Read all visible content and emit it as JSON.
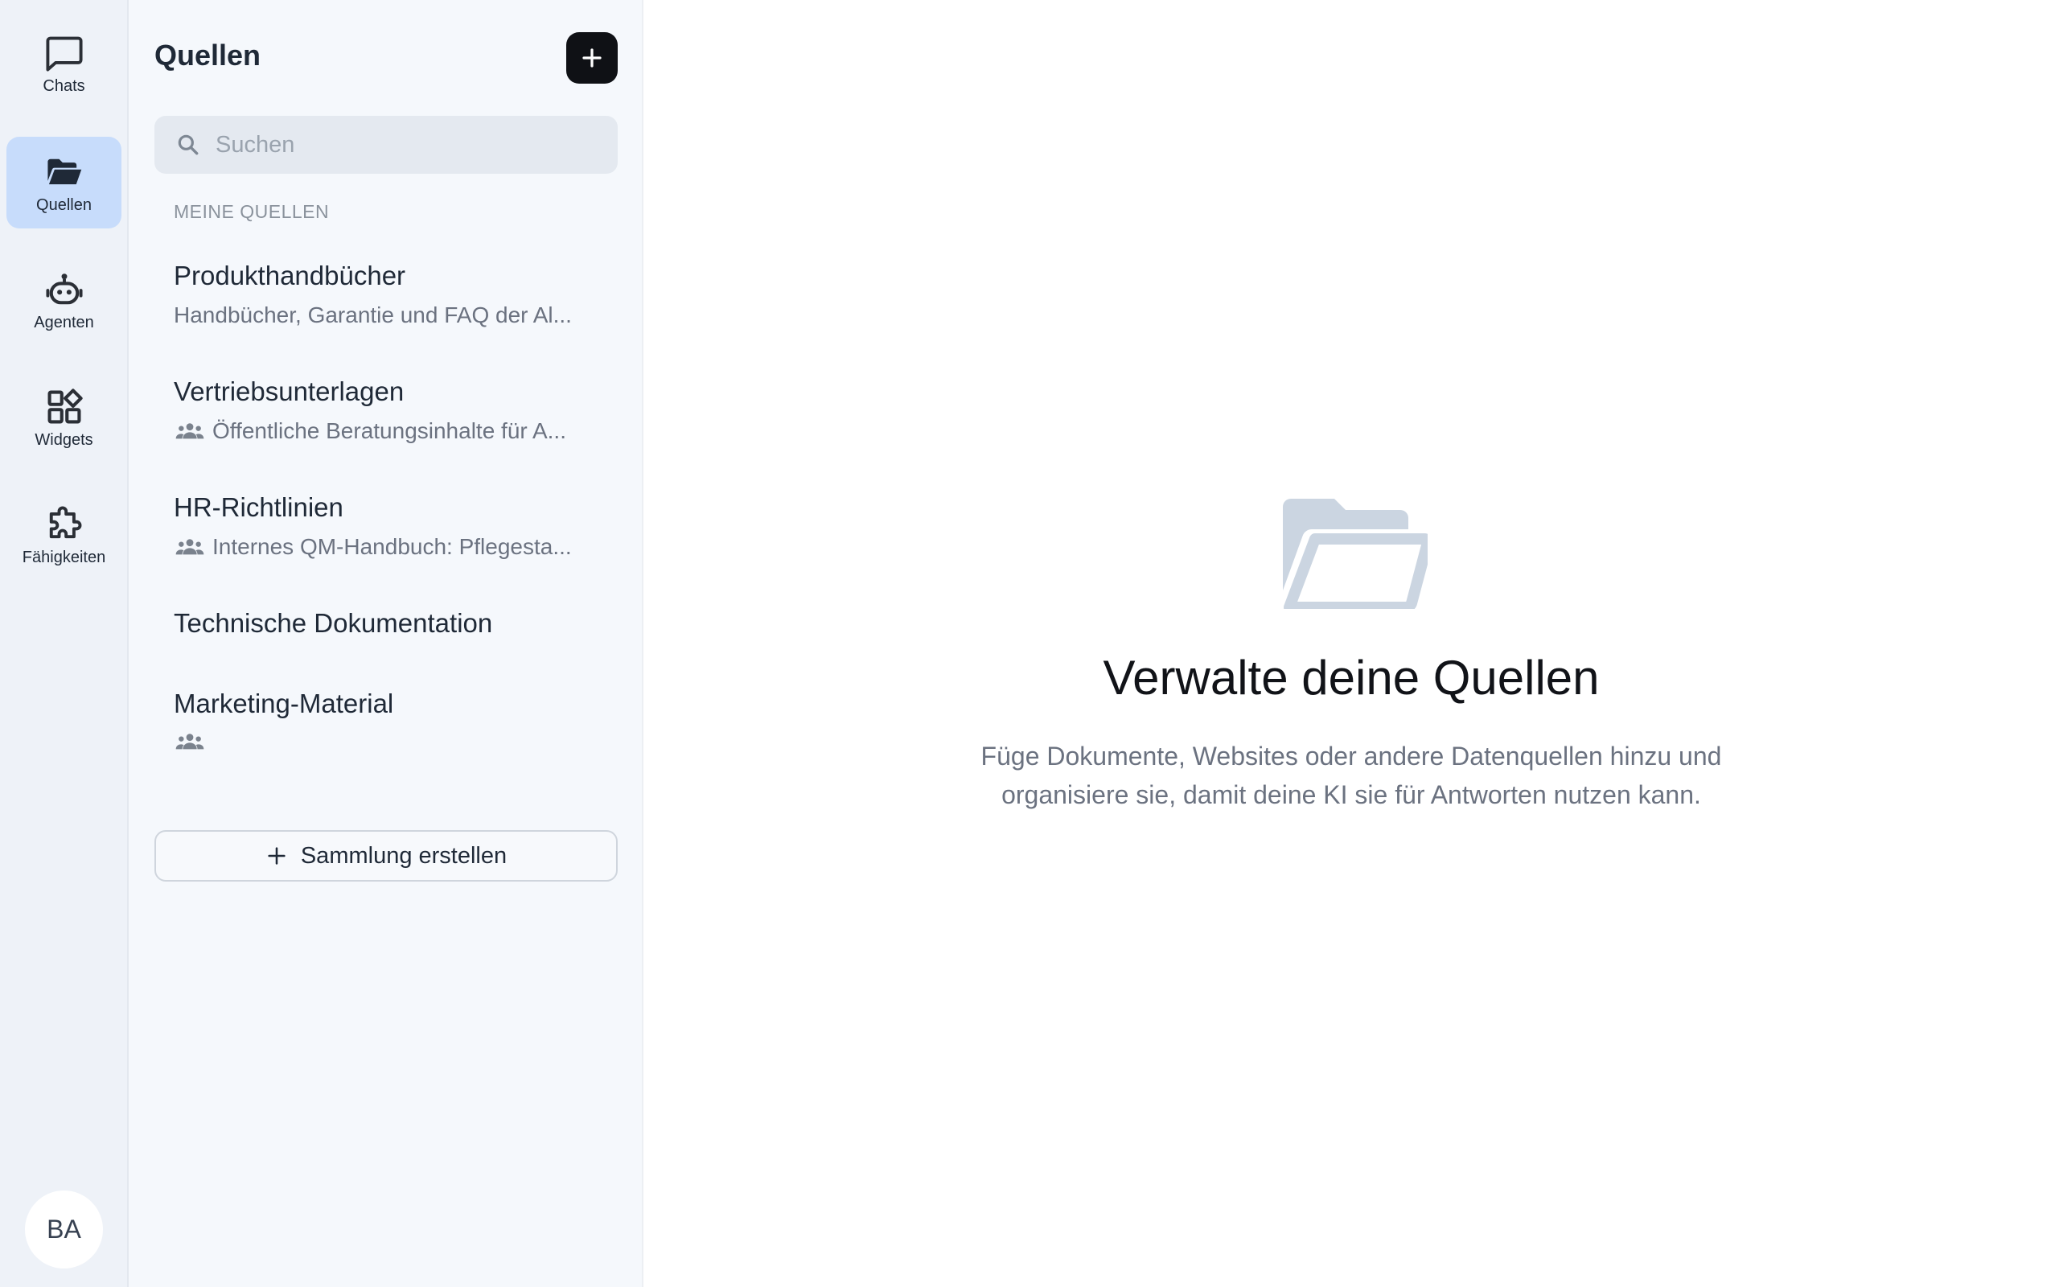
{
  "rail": {
    "items": [
      {
        "label": "Chats",
        "icon": "chat-bubble-icon",
        "active": false
      },
      {
        "label": "Quellen",
        "icon": "folder-open-icon",
        "active": true
      },
      {
        "label": "Agenten",
        "icon": "robot-icon",
        "active": false
      },
      {
        "label": "Widgets",
        "icon": "widgets-icon",
        "active": false
      },
      {
        "label": "Fähigkeiten",
        "icon": "puzzle-icon",
        "active": false
      }
    ],
    "avatar": "BA"
  },
  "panel": {
    "title": "Quellen",
    "add_icon": "plus-icon",
    "search_placeholder": "Suchen",
    "section_label": "MEINE QUELLEN",
    "sources": [
      {
        "name": "Produkthandbücher",
        "description": "Handbücher, Garantie und FAQ der Al...",
        "shared": false
      },
      {
        "name": "Vertriebsunterlagen",
        "description": "Öffentliche Beratungsinhalte für A...",
        "shared": true
      },
      {
        "name": "HR-Richtlinien",
        "description": "Internes QM-Handbuch: Pflegesta...",
        "shared": true
      },
      {
        "name": "Technische Dokumentation",
        "description": "",
        "shared": false
      },
      {
        "name": "Marketing-Material",
        "description": "",
        "shared": true
      }
    ],
    "create_label": "Sammlung erstellen"
  },
  "main": {
    "title": "Verwalte deine Quellen",
    "subtitle_line1": "Füge Dokumente, Websites oder andere Datenquellen hinzu und",
    "subtitle_line2": "organisiere sie, damit deine KI sie für Antworten nutzen kann."
  },
  "colors": {
    "accent_active": "#c7dcfb",
    "rail_bg": "#eef2f8",
    "panel_bg": "#f5f8fc",
    "primary_button": "#0f1115",
    "empty_icon": "#cbd5e1"
  }
}
